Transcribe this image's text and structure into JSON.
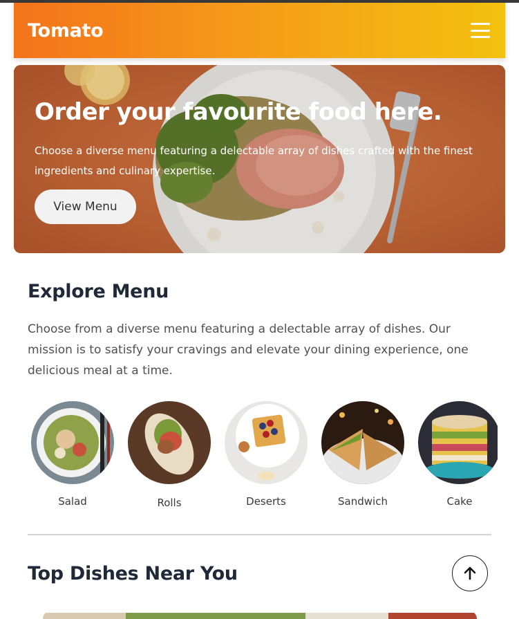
{
  "header": {
    "brand": "Tomato",
    "menu_icon": "hamburger-icon"
  },
  "hero": {
    "title": "Order your favourite food here.",
    "subtitle": "Choose a diverse menu featuring a delectable array of dishes crafted with the finest ingredients and culinary expertise.",
    "button_label": "View Menu"
  },
  "explore": {
    "title": "Explore Menu",
    "description": "Choose from a diverse menu featuring a delectable array of dishes. Our mission is to satisfy your cravings and elevate your dining experience, one delicious meal at a time.",
    "items": [
      {
        "label": "Salad"
      },
      {
        "label": "Rolls"
      },
      {
        "label": "Deserts"
      },
      {
        "label": "Sandwich"
      },
      {
        "label": "Cake"
      }
    ]
  },
  "top_dishes": {
    "title": "Top Dishes Near You"
  },
  "scroll_top": {
    "icon": "arrow-up-icon"
  },
  "colors": {
    "nav_gradient_start": "#f3731b",
    "nav_gradient_end": "#f3c20f",
    "hero_bg": "#c9683a",
    "heading": "#1f2937"
  }
}
